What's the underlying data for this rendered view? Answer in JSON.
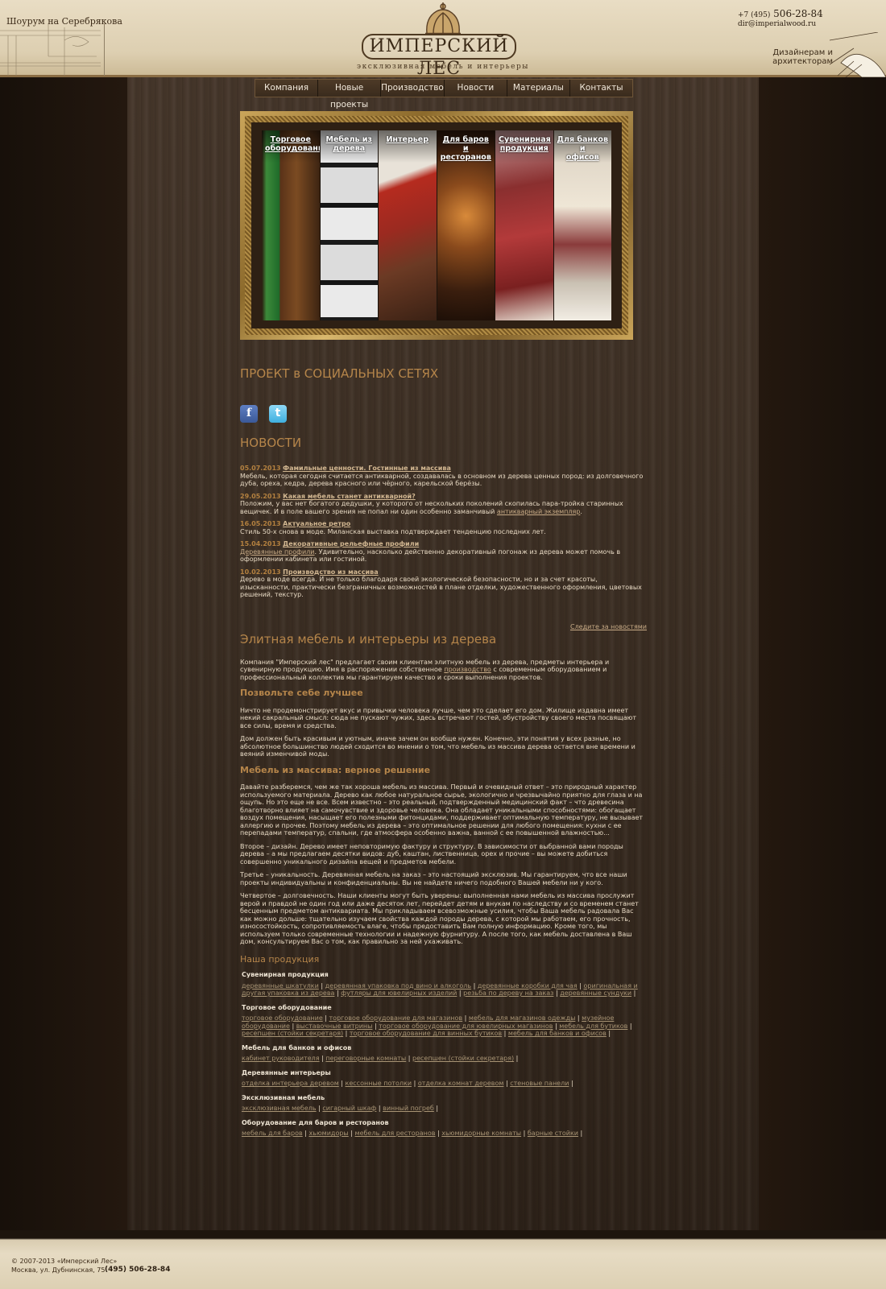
{
  "header": {
    "showroom": "Шоурум на Серебрякова",
    "logo_name": "ИМПЕРСКИЙ ЛЕС",
    "logo_tagline": "эксклюзивная мебель и интерьеры",
    "phone_code": "+7 (495)",
    "phone_number": "506-28-84",
    "email": "dir@imperialwood.ru",
    "designers_line1": "Дизайнерам и",
    "designers_line2": "архитекторам"
  },
  "nav": [
    "Компания",
    "Новые проекты",
    "Производство",
    "Новости",
    "Материалы",
    "Контакты"
  ],
  "gallery": [
    {
      "label1": "Торговое",
      "label2": "оборудование"
    },
    {
      "label1": "Мебель из",
      "label2": "дерева"
    },
    {
      "label1": "Интерьер",
      "label2": ""
    },
    {
      "label1": "Для баров и",
      "label2": "ресторанов"
    },
    {
      "label1": "Сувенирная",
      "label2": "продукция"
    },
    {
      "label1": "Для банков и",
      "label2": "офисов"
    }
  ],
  "social": {
    "title": "ПРОЕКТ в СОЦИАЛЬНЫХ СЕТЯХ",
    "facebook": "f",
    "twitter": "t"
  },
  "news": {
    "title": "НОВОСТИ",
    "items": [
      {
        "date": "05.07.2013",
        "title": "Фамильные ценности. Гостинные из массива",
        "text": "Мебель, которая сегодня считается антикварной, создавалась в основном из дерева ценных пород: из долговечного дуба, ореха, кедра, дерева красного или чёрного, карельской берёзы.",
        "link": "",
        "tail": ""
      },
      {
        "date": "29.05.2013",
        "title": "Какая мебель станет антикварной?",
        "text": "Положим, у вас нет богатого дедушки, у которого от нескольких поколений скопилась пара-тройка старинных вещичек. И в поле вашего зрения не попал ни один особенно заманчивый ",
        "link": "антикварный экземпляр",
        "tail": "."
      },
      {
        "date": "16.05.2013",
        "title": "Актуальное ретро",
        "text": "Стиль 50-х снова в моде. Миланская выставка подтверждает тенденцию последних лет.",
        "link": "",
        "tail": ""
      },
      {
        "date": "15.04.2013",
        "title": "Декоративные рельефные профили",
        "text": "",
        "link": "Деревянные профили",
        "tail": ". Удивительно, насколько действенно декоративный погонаж из дерева может помочь в оформлении кабинета или гостиной."
      },
      {
        "date": "10.02.2013",
        "title": "Производство из массива",
        "text": "Дерево в моде всегда. И не только благодаря своей экологической безопасности, но и за счет красоты, изысканности, практически безграничных возможностей в плане отделки, художественного оформления, цветовых решений, текстур.",
        "link": "",
        "tail": ""
      }
    ],
    "more": "Следите за новостями"
  },
  "about": {
    "title": "Элитная мебель и интерьеры из дерева",
    "p1_a": "Компания \"Имперский лес\"  предлагает своим клиентам элитную мебель из дерева, предметы интерьера и сувенирную продукцию. Имя в распоряжении собственное ",
    "p1_link": "производство",
    "p1_b": " с современным оборудованием и профессиональный коллектив мы гарантируем качество и сроки выполнения проектов.",
    "h_best": "Позвольте себе лучшее",
    "p2": "Ничто не продемонстрирует вкус и привычки человека лучше, чем это сделает его дом. Жилище издавна имеет некий сакральный смысл: сюда не пускают чужих, здесь встречают гостей, обустройству своего места посвящают все силы, время и средства.",
    "p3": "Дом должен быть красивым и уютным, иначе зачем он вообще нужен. Конечно, эти понятия у всех разные, но абсолютное большинство людей сходится во мнении о том, что мебель из массива дерева остается вне времени и веяний изменчивой моды.",
    "h_solid": "Мебель из массива: верное решение",
    "p4": "Давайте разберемся, чем же так хороша мебель из массива. Первый и очевидный ответ – это природный характер используемого материала. Дерево как любое натуральное сырье, экологично и чрезвычайно приятно для глаза и на ощупь. Но это еще не все. Всем известно – это реальный, подтвержденный медицинский факт – что древесина благотворно влияет на самочувствие и здоровье человека. Она обладает уникальными способностями: обогащает воздух помещения, насыщает его полезными фитонцидами, поддерживает оптимальную температуру, не вызывает аллергию и прочее. Поэтому мебель из дерева – это оптимальное решении для любого помещения: кухни с ее перепадами температур, спальни, где атмосфера особенно важна, ванной с ее повышенной влажностью...",
    "p5": "Второе – дизайн. Дерево имеет неповторимую фактуру и структуру. В зависимости от выбранной вами породы дерева – а мы предлагаем десятки видов: дуб, каштан, лиственница, орех и прочие – вы можете добиться совершенно уникального дизайна вещей и предметов мебели.",
    "p6": "Третье – уникальность. Деревянная мебель на заказ – это настоящий эксклюзив. Мы гарантируем, что все наши проекты индивидуальны и конфиденциальны. Вы не найдете ничего подобного Вашей мебели ни у кого.",
    "p7": "Четвертое – долговечность. Наши клиенты могут быть уверены: выполненная нами мебель из массива прослужит верой и правдой не один год или даже десяток лет, перейдет детям и внукам по наследству и со временем станет бесценным предметом антиквариата. Мы прикладываем всевозможные усилия, чтобы Ваша мебель радовала Вас как можно дольше: тщательно изучаем свойства каждой породы дерева, с которой мы работаем, его прочность, износостойкость, сопротивляемость влаге, чтобы предоставить Вам полную информацию. Кроме того, мы используем только современные технологии и надежную фурнитуру. А после того, как мебель доставлена в Ваш дом, консультируем Вас о том, как правильно за ней ухаживать."
  },
  "products": {
    "title": "Наша продукция",
    "categories": [
      {
        "name": "Сувенирная продукция",
        "links": [
          "деревянные шкатулки",
          "деревянная упаковка под вино и алкоголь",
          "деревянные коробки для чая",
          "оригинальная и другая упаковка из дерева",
          "футляры для ювелирных изделий",
          "резьба по дереву на заказ",
          "деревянные сундуки"
        ]
      },
      {
        "name": "Торговое оборудование",
        "links": [
          "торговое оборудование",
          "торговое оборудование для магазинов",
          "мебель для магазинов одежды",
          "музейное оборудование",
          "выставочные витрины",
          "торговое оборудование для ювелирных магазинов",
          "мебель для бутиков",
          "ресепшен (стойки секретаря)",
          "торговое оборудование для винных бутиков",
          "мебель для банков и офисов"
        ]
      },
      {
        "name": "Мебель для банков и офисов",
        "links": [
          "кабинет руководителя",
          "переговорные комнаты",
          "ресепшен (стойки секретаря)"
        ]
      },
      {
        "name": "Деревянные интерьеры",
        "links": [
          "отделка интерьера деревом",
          "кессонные потолки",
          "отделка комнат деревом",
          "стеновые панели"
        ]
      },
      {
        "name": "Эксклюзивная мебель",
        "links": [
          "эксклюзивная мебель",
          "сигарный шкаф",
          "винный погреб"
        ]
      },
      {
        "name": "Оборудование для баров и ресторанов",
        "links": [
          "мебель для баров",
          "хьюмидоры",
          "мебель для ресторанов",
          "хьюмидорные комнаты",
          "барные стойки"
        ]
      }
    ]
  },
  "footer": {
    "copyright": "© 2007-2013 «Имперский Лес»",
    "address": "Москва, ул. Дубнинская, 75",
    "phone": "(495) 506-28-84"
  },
  "colors": {
    "accent": "#b5854a",
    "header_bg": "#e2d5bb",
    "wood": "#3d3025",
    "text": "#e7d9c3"
  }
}
